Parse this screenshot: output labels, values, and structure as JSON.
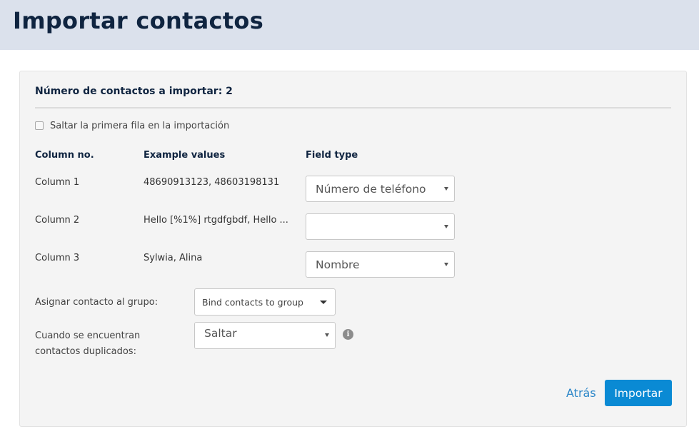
{
  "header": {
    "title": "Importar contactos"
  },
  "panel": {
    "count_title": "Número de contactos a importar: 2",
    "skip_first_row": {
      "label": "Saltar la primera fila en la importación",
      "checked": false
    },
    "table": {
      "headers": [
        "Column no.",
        "Example values",
        "Field type"
      ],
      "rows": [
        {
          "column": "Column 1",
          "examples": "48690913123, 48603198131",
          "field_type": "Número de teléfono"
        },
        {
          "column": "Column 2",
          "examples": "Hello [%1%] rtgdfgbdf, Hello ...",
          "field_type": ""
        },
        {
          "column": "Column 3",
          "examples": "Sylwia, Alina",
          "field_type": "Nombre"
        }
      ]
    },
    "group": {
      "label": "Asignar contacto al grupo:",
      "placeholder": "Bind contacts to group"
    },
    "duplicates": {
      "label_line1": "Cuando se encuentran",
      "label_line2": "contactos duplicados:",
      "value": "Saltar",
      "info_icon": "info-icon"
    },
    "actions": {
      "back_label": "Atrás",
      "import_label": "Importar"
    }
  },
  "colors": {
    "header_bg": "#dbe1ec",
    "title_color": "#0f2440",
    "accent": "#0a8ad4",
    "link": "#2b86c8",
    "panel_bg": "#f4f4f4"
  }
}
